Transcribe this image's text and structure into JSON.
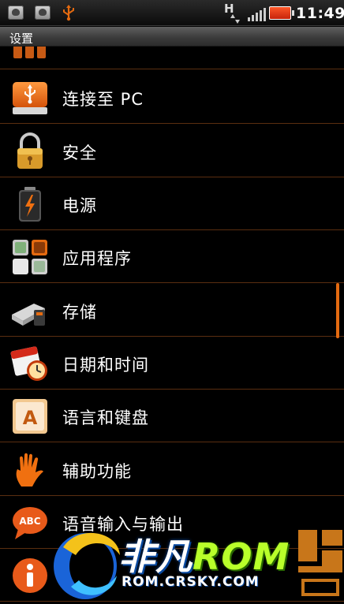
{
  "statusbar": {
    "time": "11:49",
    "network": "H"
  },
  "titlebar": {
    "title": "设置"
  },
  "items": [
    {
      "label": "",
      "icon": "mobile-network-icon"
    },
    {
      "label": "连接至 PC",
      "icon": "usb-drive-icon"
    },
    {
      "label": "安全",
      "icon": "padlock-icon"
    },
    {
      "label": "电源",
      "icon": "battery-icon"
    },
    {
      "label": "应用程序",
      "icon": "applications-grid-icon"
    },
    {
      "label": "存储",
      "icon": "storage-usb-icon"
    },
    {
      "label": "日期和时间",
      "icon": "calendar-clock-icon"
    },
    {
      "label": "语言和键盘",
      "icon": "keyboard-key-icon"
    },
    {
      "label": "辅助功能",
      "icon": "hand-icon"
    },
    {
      "label": "语音输入与输出",
      "icon": "speech-bubble-icon"
    },
    {
      "label": "",
      "icon": "info-icon"
    }
  ],
  "watermark": {
    "brand_a": "非凡",
    "brand_b": "ROM",
    "url": "ROM.CRSKY.COM"
  },
  "colors": {
    "divider": "#5a2e10",
    "accent": "#e46a10"
  }
}
